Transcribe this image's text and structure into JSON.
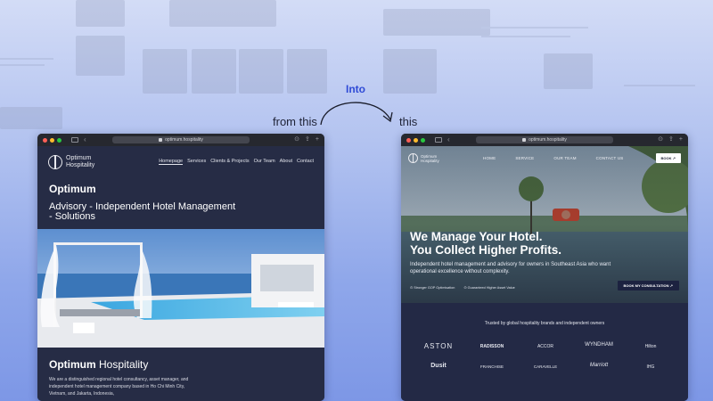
{
  "annotations": {
    "from_label": "from this",
    "into_label": "Into",
    "to_label": "this"
  },
  "old_site": {
    "url": "optimum.hospitality",
    "logo_line1": "Optimum",
    "logo_line2": "Hospitality",
    "nav": [
      "Homepage",
      "Services",
      "Clients & Projects",
      "Our Team",
      "About",
      "Contact"
    ],
    "heading": "Optimum",
    "subheading": "Advisory - Independent Hotel Management - Solutions",
    "section_heading_bold": "Optimum",
    "section_heading_rest": " Hospitality",
    "paragraph": "We are a distinguished regional hotel consultancy, asset manager, and independent hotel management company based in Ho Chi Minh City, Vietnam, and Jakarta, Indonesia,"
  },
  "new_site": {
    "url": "optimum.hospitality",
    "logo_line1": "Optimum",
    "logo_line2": "Hospitality",
    "nav": [
      "HOME",
      "SERVICE",
      "OUR TEAM",
      "CONTACT US"
    ],
    "book_button": "BOOK ↗",
    "hero_line1": "We Manage Your Hotel.",
    "hero_line2": "You Collect Higher Profits.",
    "hero_sub": "Independent hotel management and advisory for owners in Southeast Asia who want operational excellence without complexity.",
    "checks": [
      "Stronger GOP Optimisation",
      "Guaranteed Higher Asset Value"
    ],
    "consult_button": "BOOK MY CONSULTATION ↗",
    "trust_title": "Trusted by global hospitality brands and independent owners",
    "brands_row1": [
      "ASTON",
      "RADISSON",
      "ACCOR",
      "WYNDHAM",
      "Hilton"
    ],
    "brands_row2": [
      "Dusit",
      "FRANCHISE",
      "CARAVELLE",
      "Marriott",
      "IHG"
    ]
  },
  "colors": {
    "accent": "#2f4bd6",
    "window_bg": "#1f2438"
  }
}
